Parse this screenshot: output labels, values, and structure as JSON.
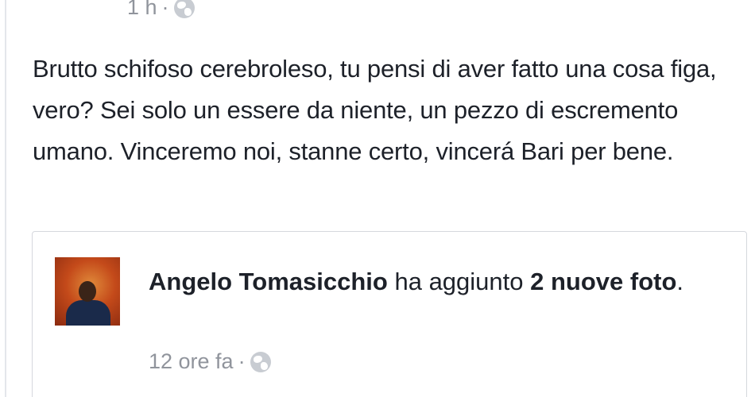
{
  "post": {
    "timestamp": "1 h",
    "separator": "·",
    "privacy_icon": "globe-icon",
    "text": "Brutto schifoso cerebroleso, tu pensi di aver fatto una cosa figa, vero? Sei solo un essere da niente, un pezzo di escremento umano. Vinceremo noi, stanne certo, vincerá Bari per bene."
  },
  "shared": {
    "author": "Angelo Tomasicchio",
    "action": " ha aggiunto ",
    "photo_count": "2 nuove foto",
    "end": ".",
    "timestamp": "12 ore fa",
    "separator": "·",
    "privacy_icon": "globe-icon"
  },
  "colors": {
    "text": "#1d2129",
    "meta": "#90949c",
    "border": "#d5d8dd"
  }
}
